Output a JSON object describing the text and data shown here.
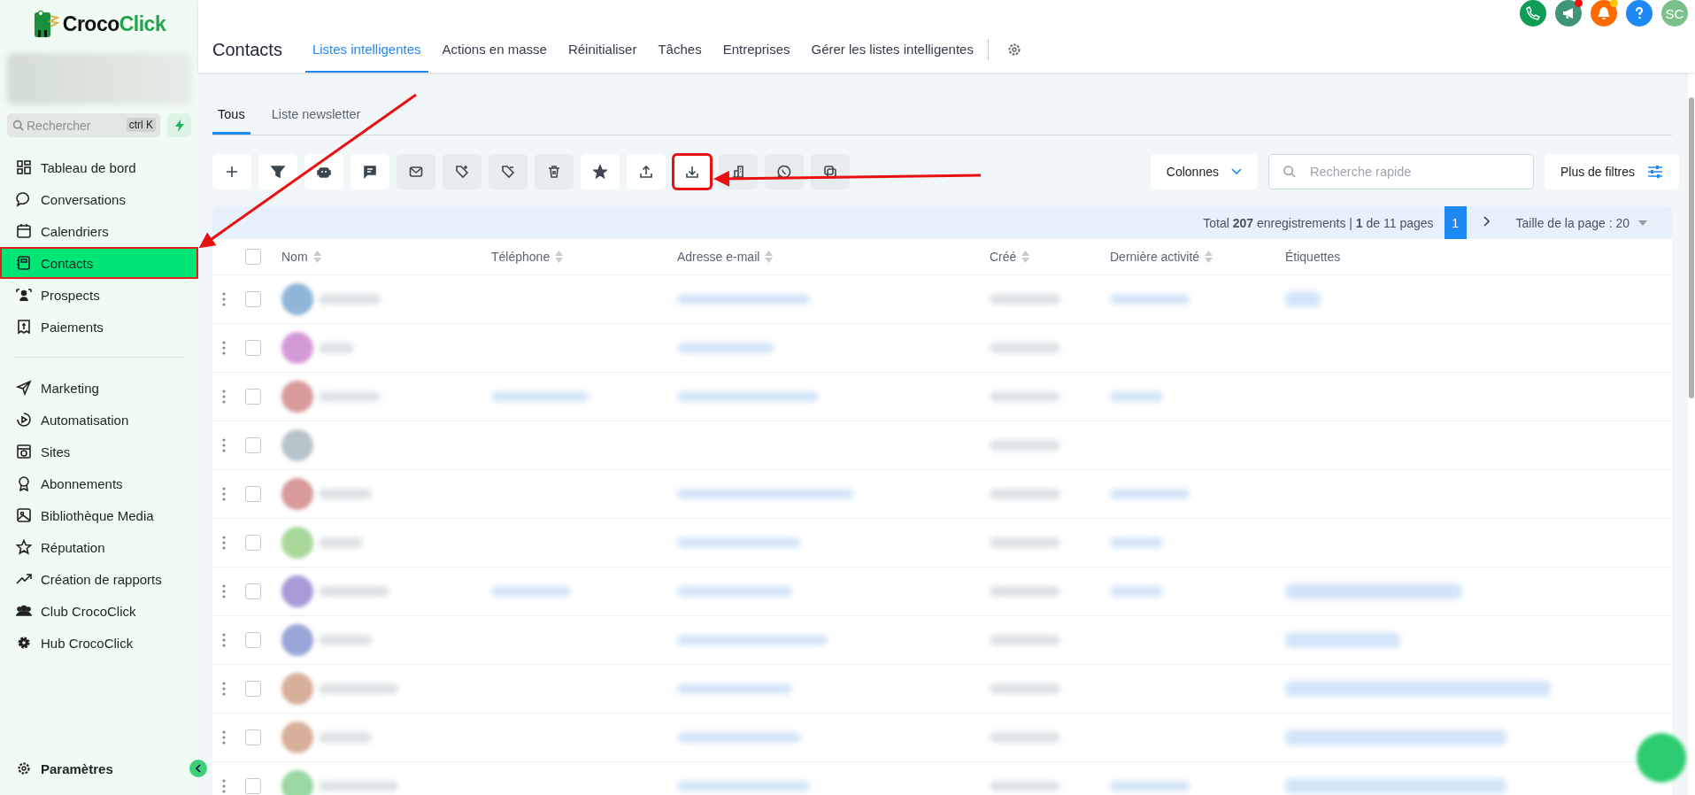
{
  "sidebar": {
    "logo": {
      "prefix": "Croco",
      "suffix": "Click"
    },
    "search": {
      "placeholder": "Rechercher",
      "shortcut": "ctrl K"
    },
    "groups": [
      [
        {
          "label": "Tableau de bord",
          "selected": false,
          "highlighted": false
        },
        {
          "label": "Conversations",
          "selected": false,
          "highlighted": false
        },
        {
          "label": "Calendriers",
          "selected": false,
          "highlighted": false
        },
        {
          "label": "Contacts",
          "selected": true,
          "highlighted": true
        },
        {
          "label": "Prospects",
          "selected": false,
          "highlighted": false
        },
        {
          "label": "Paiements",
          "selected": false,
          "highlighted": false
        }
      ],
      [
        {
          "label": "Marketing",
          "selected": false,
          "highlighted": false
        },
        {
          "label": "Automatisation",
          "selected": false,
          "highlighted": false
        },
        {
          "label": "Sites",
          "selected": false,
          "highlighted": false
        },
        {
          "label": "Abonnements",
          "selected": false,
          "highlighted": false
        },
        {
          "label": "Bibliothèque Media",
          "selected": false,
          "highlighted": false
        },
        {
          "label": "Réputation",
          "selected": false,
          "highlighted": false
        },
        {
          "label": "Création de rapports",
          "selected": false,
          "highlighted": false
        },
        {
          "label": "Club CrocoClick",
          "selected": false,
          "highlighted": false
        },
        {
          "label": "Hub CrocoClick",
          "selected": false,
          "highlighted": false
        }
      ]
    ],
    "settings": {
      "label": "Paramètres"
    }
  },
  "header": {
    "title": "Contacts",
    "tabs": [
      {
        "label": "Listes intelligentes",
        "selected": true
      },
      {
        "label": "Actions en masse",
        "selected": false
      },
      {
        "label": "Réinitialiser",
        "selected": false
      },
      {
        "label": "Tâches",
        "selected": false
      },
      {
        "label": "Entreprises",
        "selected": false
      },
      {
        "label": "Gérer les listes intelligentes",
        "selected": false
      }
    ],
    "top_icons": [
      {
        "kind": "phone",
        "color": "#0f9d58",
        "badge": false
      },
      {
        "kind": "megaphone",
        "color": "#3f9479",
        "badge": true
      },
      {
        "kind": "bell",
        "color": "#ff6a00",
        "badge": true
      },
      {
        "kind": "help",
        "color": "#1e88f5",
        "badge": false
      },
      {
        "kind": "avatar",
        "color": "#7cc08a",
        "badge": false,
        "initials": "SC"
      }
    ]
  },
  "subtabs": [
    {
      "label": "Tous",
      "selected": true
    },
    {
      "label": "Liste newsletter",
      "selected": false
    }
  ],
  "toolbar": [
    {
      "kind": "plus",
      "disabled": false,
      "highlighted": false
    },
    {
      "kind": "filter",
      "disabled": false,
      "highlighted": false
    },
    {
      "kind": "robot",
      "disabled": false,
      "highlighted": false
    },
    {
      "kind": "message",
      "disabled": false,
      "highlighted": false
    },
    {
      "kind": "mail",
      "disabled": true,
      "highlighted": false
    },
    {
      "kind": "tag-plus",
      "disabled": true,
      "highlighted": false
    },
    {
      "kind": "tag-minus",
      "disabled": true,
      "highlighted": false
    },
    {
      "kind": "trash",
      "disabled": true,
      "highlighted": false
    },
    {
      "kind": "star",
      "disabled": false,
      "highlighted": false
    },
    {
      "kind": "upload",
      "disabled": false,
      "highlighted": false
    },
    {
      "kind": "download",
      "disabled": false,
      "highlighted": true
    },
    {
      "kind": "building",
      "disabled": true,
      "highlighted": false
    },
    {
      "kind": "whatsapp",
      "disabled": true,
      "highlighted": false
    },
    {
      "kind": "copy",
      "disabled": true,
      "highlighted": false
    }
  ],
  "columns_button": "Colonnes",
  "quick_search": {
    "placeholder": "Recherche rapide"
  },
  "more_filters": "Plus de filtres",
  "pagination": {
    "summary": "Total **207** enregistrements | **1** de 11 pages",
    "pages": [
      {
        "label": "1",
        "selected": true
      }
    ],
    "page_size": "Taille de la page : 20"
  },
  "table": {
    "all_checked": false,
    "columns": [
      {
        "label": "Nom",
        "sortable": true
      },
      {
        "label": "Téléphone",
        "sortable": true
      },
      {
        "label": "Adresse e-mail",
        "sortable": true
      },
      {
        "label": "Créé",
        "sortable": true
      },
      {
        "label": "Dernière activité",
        "sortable": true
      },
      {
        "label": "Étiquettes",
        "sortable": false
      }
    ],
    "rows": [
      {
        "color": "#8fb6d8",
        "checked": false
      },
      {
        "color": "#d49ad8",
        "checked": false
      },
      {
        "color": "#d89a9a",
        "checked": false
      },
      {
        "color": "#b8c4cc",
        "checked": false
      },
      {
        "color": "#d89a9a",
        "checked": false
      },
      {
        "color": "#a8d89a",
        "checked": false
      },
      {
        "color": "#a89ad8",
        "checked": false
      },
      {
        "color": "#9aa6d8",
        "checked": false
      },
      {
        "color": "#d8b09a",
        "checked": false
      },
      {
        "color": "#d8b09a",
        "checked": false
      },
      {
        "color": "#9ad8a4",
        "checked": false
      }
    ]
  }
}
